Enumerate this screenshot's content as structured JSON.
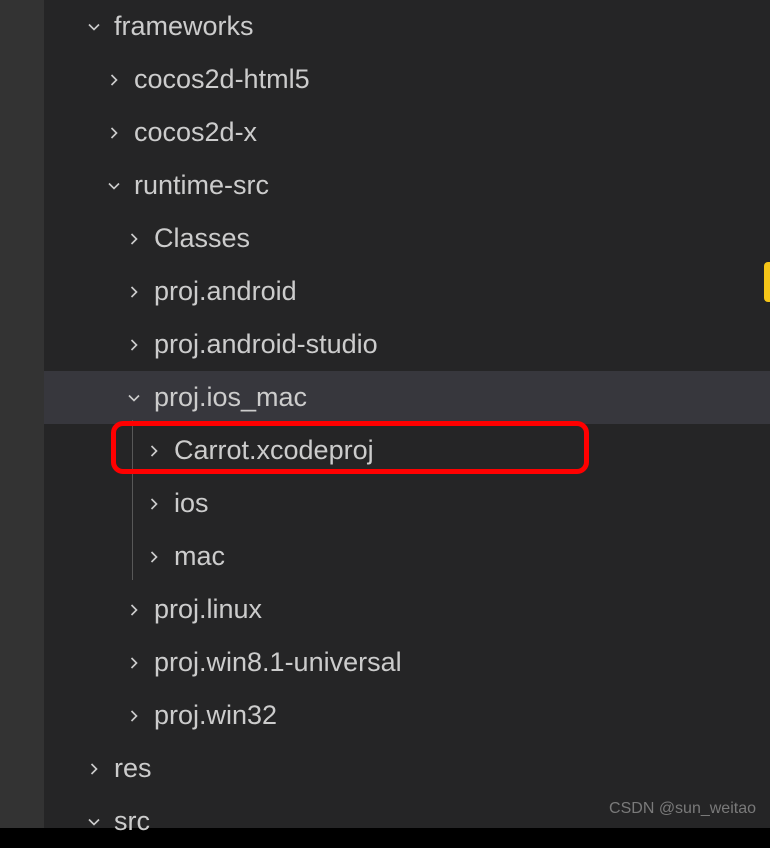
{
  "tree": {
    "frameworks": "frameworks",
    "cocos2d_html5": "cocos2d-html5",
    "cocos2d_x": "cocos2d-x",
    "runtime_src": "runtime-src",
    "classes": "Classes",
    "proj_android": "proj.android",
    "proj_android_studio": "proj.android-studio",
    "proj_ios_mac": "proj.ios_mac",
    "carrot_xcodeproj": "Carrot.xcodeproj",
    "ios": "ios",
    "mac": "mac",
    "proj_linux": "proj.linux",
    "proj_win81": "proj.win8.1-universal",
    "proj_win32": "proj.win32",
    "res": "res",
    "src": "src"
  },
  "watermark": "CSDN @sun_weitao"
}
